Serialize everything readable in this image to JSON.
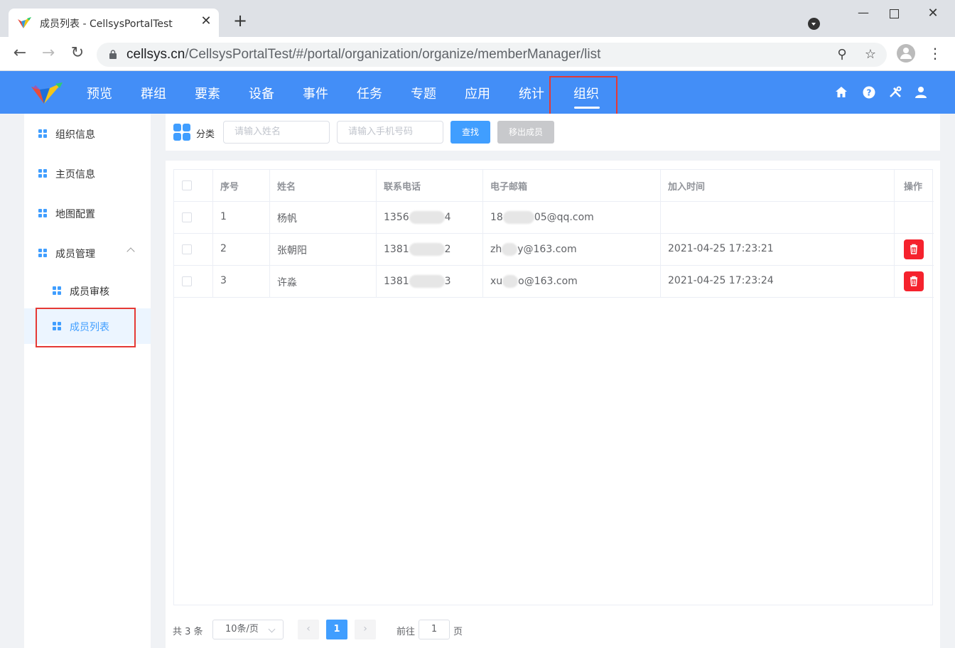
{
  "browser": {
    "tab_title": "成员列表 - CellsysPortalTest",
    "url_domain": "cellsys.cn",
    "url_path": "/CellsysPortalTest/#/portal/organization/organize/memberManager/list"
  },
  "nav": {
    "items": [
      "预览",
      "群组",
      "要素",
      "设备",
      "事件",
      "任务",
      "专题",
      "应用",
      "统计",
      "组织"
    ],
    "active": "组织"
  },
  "sidebar": {
    "items": [
      {
        "label": "组织信息"
      },
      {
        "label": "主页信息"
      },
      {
        "label": "地图配置"
      },
      {
        "label": "成员管理"
      }
    ],
    "sub_items": [
      {
        "label": "成员审核"
      },
      {
        "label": "成员列表",
        "active": true
      }
    ]
  },
  "toolbar": {
    "category_label": "分类",
    "name_placeholder": "请输入姓名",
    "phone_placeholder": "请输入手机号码",
    "search_label": "查找",
    "remove_label": "移出成员"
  },
  "table": {
    "headers": [
      "序号",
      "姓名",
      "联系电话",
      "电子邮箱",
      "加入时间",
      "操作"
    ],
    "rows": [
      {
        "index": "1",
        "name": "杨帆",
        "phone_start": "1356",
        "phone_end": "4",
        "email_start": "18",
        "email_end": "05@qq.com",
        "joined": ""
      },
      {
        "index": "2",
        "name": "张朝阳",
        "phone_start": "1381",
        "phone_end": "2",
        "email_start": "zh",
        "email_end": "y@163.com",
        "joined": "2021-04-25 17:23:21"
      },
      {
        "index": "3",
        "name": "许淼",
        "phone_start": "1381",
        "phone_end": "3",
        "email_start": "xu",
        "email_end": "o@163.com",
        "joined": "2021-04-25 17:23:24"
      }
    ]
  },
  "pager": {
    "total": "共 3 条",
    "page_size": "10条/页",
    "current": "1",
    "goto_prefix": "前往",
    "goto_value": "1",
    "goto_suffix": "页"
  },
  "colors": {
    "header_bg": "#438ef7",
    "primary": "#409eff",
    "danger": "#f5222d",
    "highlight": "#e53935"
  }
}
